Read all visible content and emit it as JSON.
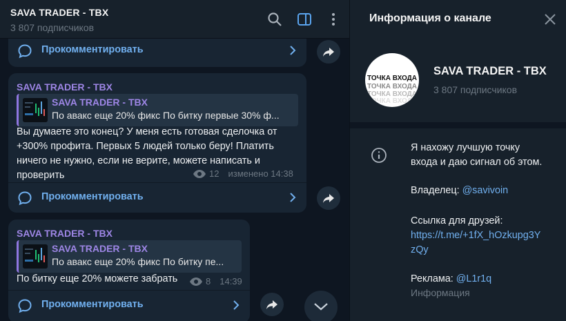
{
  "chat": {
    "title": "SAVA TRADER - TBX",
    "subscribers": "3 807 подписчиков"
  },
  "messages": [
    {
      "comment_label": "Прокомментировать"
    },
    {
      "author": "SAVA TRADER - TBX",
      "quote_author": "SAVA TRADER - TBX",
      "quote_text": "По авакс еще 20% фикс  По битку первые 30% ф...",
      "text_lines": [
        "Вы думаете это конец? У меня есть готовая сделочка от",
        "+300% профита. Первых 5 людей только беру! Платить",
        "ничего не нужно, если не верите, можете написать и",
        "проверить"
      ],
      "views": "12",
      "time": "изменено 14:38",
      "comment_label": "Прокомментировать"
    },
    {
      "author": "SAVA TRADER - TBX",
      "quote_author": "SAVA TRADER - TBX",
      "quote_text": "По авакс еще 20% фикс  По битку пе...",
      "text": "По битку еще 20% можете забрать",
      "views": "8",
      "time": "14:39",
      "comment_label": "Прокомментировать"
    }
  ],
  "info": {
    "header_title": "Информация о канале",
    "name": "SAVA TRADER - TBX",
    "subscribers": "3 807 подписчиков",
    "avatar_lines": [
      "ТОЧКА ВХОДА",
      "ТОЧКА ВХОДА",
      "ТОЧКА ВХОДА",
      "ТОЧКА ВХОДА"
    ],
    "description_lines": [
      "Я нахожу лучшую точку",
      "входа и даю сигнал об этом."
    ],
    "owner_label": "Владелец:",
    "owner_handle": "@savivoin",
    "friends_label": "Ссылка для друзей:",
    "friends_link_lines": [
      "https://t.me/+1fX_hOzkupg3Y",
      "zQy"
    ],
    "ads_label": "Реклама:",
    "ads_handle": "@L1r1q",
    "caption": "Информация"
  },
  "colors": {
    "accent": "#71b0ef",
    "author": "#9e86e6",
    "bubble": "#182533",
    "panel": "#17212b",
    "background": "#0e1621"
  },
  "icons": [
    "search-icon",
    "sidebar-toggle-icon",
    "more-vertical-icon",
    "comment-icon",
    "chevron-right-icon",
    "share-icon",
    "eye-icon",
    "chevron-down-icon",
    "close-icon",
    "info-icon"
  ]
}
